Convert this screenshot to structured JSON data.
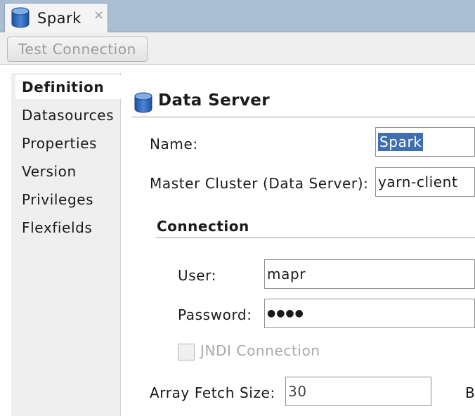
{
  "tab": {
    "title": "Spark",
    "close_glyph": "×",
    "icon": "database-icon"
  },
  "toolbar": {
    "test_connection_label": "Test Connection"
  },
  "nav": {
    "items": [
      {
        "label": "Definition",
        "active": true
      },
      {
        "label": "Datasources"
      },
      {
        "label": "Properties"
      },
      {
        "label": "Version"
      },
      {
        "label": "Privileges"
      },
      {
        "label": "Flexfields"
      }
    ]
  },
  "section": {
    "title": "Data Server",
    "icon": "database-icon"
  },
  "form": {
    "name_label": "Name:",
    "name_value": "Spark",
    "master_cluster_label": "Master Cluster (Data Server):",
    "master_cluster_value": "yarn-client",
    "connection_title": "Connection",
    "user_label": "User:",
    "user_value": "mapr",
    "password_label": "Password:",
    "password_value": "●●●●",
    "jndi_label": "JNDI Connection",
    "jndi_checked": false,
    "array_fetch_label": "Array Fetch Size:",
    "array_fetch_value": "30",
    "truncated_next_label": "B"
  },
  "colors": {
    "tab_strip": "#a9bdd3",
    "selection": "#3f6fb0",
    "panel_bg": "#efefef",
    "disabled_text": "#9c9c9c"
  }
}
